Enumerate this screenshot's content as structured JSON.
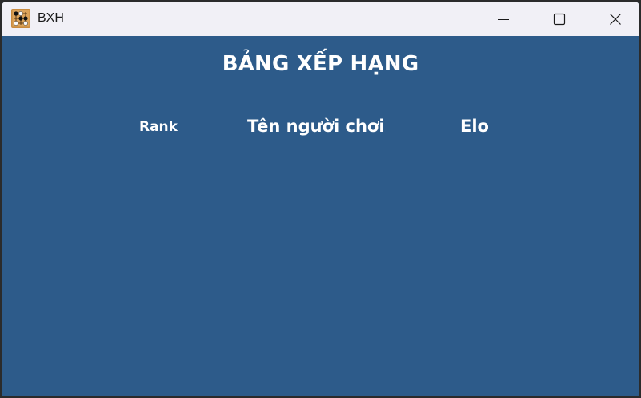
{
  "window": {
    "title": "BXH",
    "icon": "go-board-icon"
  },
  "controls": {
    "minimize": "minimize-icon",
    "maximize": "maximize-icon",
    "close": "close-icon"
  },
  "leaderboard": {
    "heading": "BẢNG XẾP HẠNG",
    "columns": {
      "rank": "Rank",
      "player_name": "Tên người chơi",
      "elo": "Elo"
    },
    "rows": []
  },
  "colors": {
    "background": "#2d5b8a",
    "titlebar": "#f1f0f6",
    "text": "#ffffff"
  }
}
